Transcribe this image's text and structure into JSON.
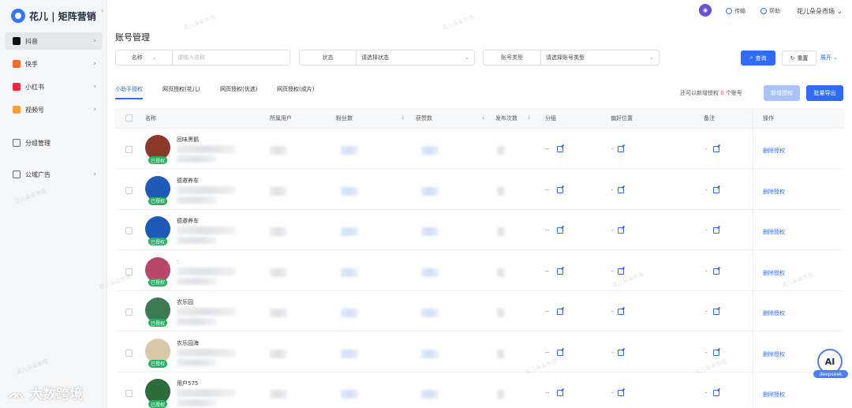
{
  "app": {
    "brand": "花儿",
    "product": "矩阵营销"
  },
  "sidebar": {
    "items": [
      {
        "label": "抖音",
        "active": true,
        "color": "#111111"
      },
      {
        "label": "快手",
        "color": "#ff6a2b"
      },
      {
        "label": "小红书",
        "color": "#ff2442"
      },
      {
        "label": "视频号",
        "color": "#f7a03b"
      },
      {
        "label": "分组管理",
        "color": "#666666"
      },
      {
        "label": "公域广告",
        "color": "#666666"
      }
    ]
  },
  "topbar": {
    "item1": "传输",
    "item2": "帮助",
    "user": "花儿朵朵市场"
  },
  "page": {
    "title": "账号管理"
  },
  "filters": {
    "name_label": "名称",
    "name_placeholder": "请输入名称",
    "status_label": "状态",
    "status_value": "请选择状态",
    "type_label": "账号类型",
    "type_value": "请选择账号类型",
    "query": "查询",
    "reset": "重置",
    "expand": "展开"
  },
  "tabs": [
    "小助手授权",
    "网页授权(花儿)",
    "网页授权(优选)",
    "网页授权(成片)"
  ],
  "quota": {
    "prefix": "还可以新增授权",
    "count": "0",
    "suffix": "个账号"
  },
  "actions": {
    "add": "新增授权",
    "export": "批量导出"
  },
  "table": {
    "columns": {
      "name": "名称",
      "owner": "所属用户",
      "fans": "粉丝数",
      "likes": "获赞数",
      "posts": "发布次数",
      "group": "分组",
      "pref": "偏好位置",
      "note": "备注",
      "op": "操作"
    },
    "auth_badge": "已授权",
    "revoke_label": "删除授权",
    "rows": [
      {
        "name": "回味黑鹅",
        "group": "--",
        "pref": "-",
        "note": "-"
      },
      {
        "name": "德邀养车",
        "group": "--",
        "pref": "-",
        "note": "-"
      },
      {
        "name": "德邀养车",
        "group": "--",
        "pref": "-",
        "note": "-"
      },
      {
        "name": "·",
        "group": "--",
        "pref": "-",
        "note": "-"
      },
      {
        "name": "农乐园",
        "group": "--",
        "pref": "-",
        "note": "-"
      },
      {
        "name": "农乐园海",
        "group": "--",
        "pref": "-",
        "note": "-"
      },
      {
        "name": "用户575",
        "group": "--",
        "pref": "-",
        "note": "-"
      }
    ]
  },
  "watermark": "花儿朵朵市场",
  "overlay": {
    "bottom_logo": "大数跨境",
    "ai_label": "AI",
    "ai_tag": "deepseek"
  }
}
